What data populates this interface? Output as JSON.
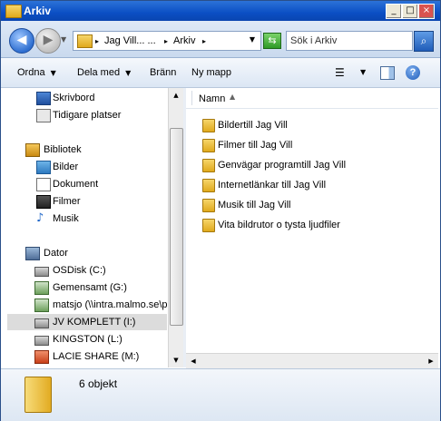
{
  "window": {
    "title": "Arkiv",
    "controls": [
      "_",
      "□",
      "×"
    ]
  },
  "address": {
    "breadcrumbs": [
      "Jag Vill... ...",
      "Arkiv"
    ],
    "search_placeholder": "Sök i Arkiv"
  },
  "toolbar": {
    "organize": "Ordna",
    "share": "Dela med",
    "burn": "Bränn",
    "new_folder": "Ny mapp"
  },
  "nav": {
    "favorites": [
      {
        "label": "Skrivbord",
        "icon": "desktop-icon"
      },
      {
        "label": "Tidigare platser",
        "icon": "recent-places-icon"
      }
    ],
    "libraries_header": "Bibliotek",
    "libraries": [
      {
        "label": "Bilder",
        "icon": "pictures-icon"
      },
      {
        "label": "Dokument",
        "icon": "documents-icon"
      },
      {
        "label": "Filmer",
        "icon": "videos-icon"
      },
      {
        "label": "Musik",
        "icon": "music-icon"
      }
    ],
    "computer_header": "Dator",
    "drives": [
      {
        "label": "OSDisk (C:)",
        "icon": "drive-icon"
      },
      {
        "label": "Gemensamt (G:)",
        "icon": "network-drive-icon"
      },
      {
        "label": "matsjo (\\\\intra.malmo.se\\p",
        "icon": "network-drive-icon"
      },
      {
        "label": "JV KOMPLETT (I:)",
        "icon": "usb-drive-icon",
        "selected": true
      },
      {
        "label": "KINGSTON (L:)",
        "icon": "usb-drive-icon"
      },
      {
        "label": "LACIE SHARE (M:)",
        "icon": "lacie-drive-icon"
      }
    ]
  },
  "content": {
    "column": "Namn",
    "items": [
      "Bildertill Jag Vill",
      "Filmer till Jag Vill",
      "Genvägar programtill Jag Vill",
      "Internetlänkar till Jag Vill",
      "Musik till Jag Vill",
      "Vita bildrutor o tysta ljudfiler"
    ]
  },
  "details": {
    "count": "6 objekt"
  },
  "colors": {
    "titlebar": "#0b4fc4",
    "selection": "#dcdcdc",
    "folder": "#e0a91c"
  }
}
